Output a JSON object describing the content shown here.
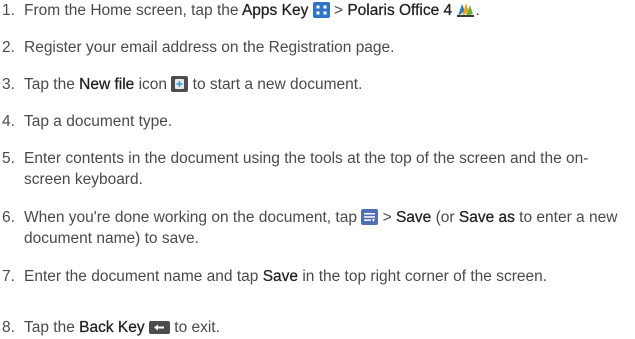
{
  "steps": [
    {
      "number": "1.",
      "parts": {
        "a": "From the Home screen, tap the ",
        "b": "Apps Key",
        "c": " > ",
        "d": "Polaris Office 4",
        "e": "."
      },
      "icons": [
        "apps-grid-icon",
        "polaris-office-icon"
      ]
    },
    {
      "number": "2.",
      "text": "Register your email address on the Registration page."
    },
    {
      "number": "3.",
      "parts": {
        "a": "Tap the ",
        "b": "New file",
        "c": " icon ",
        "d": " to start a new document."
      },
      "icons": [
        "new-file-icon"
      ]
    },
    {
      "number": "4.",
      "text": "Tap a document type."
    },
    {
      "number": "5.",
      "text": "Enter contents in the document using the tools at the top of the screen and the on-screen keyboard."
    },
    {
      "number": "6.",
      "parts": {
        "a": "When you're done working on the document, tap ",
        "b": " > ",
        "c": "Save",
        "d": " (or ",
        "e": "Save as",
        "f": " to enter a new document name) to save."
      },
      "icons": [
        "menu-icon"
      ]
    },
    {
      "number": "7.",
      "parts": {
        "a": "Enter the document name and tap ",
        "b": "Save",
        "c": " in the top right corner of the screen."
      }
    },
    {
      "number": "8.",
      "parts": {
        "a": "Tap the ",
        "b": "Back Key",
        "c": " to exit."
      },
      "icons": [
        "back-key-icon"
      ]
    }
  ],
  "colors": {
    "text": "#4a4a4a",
    "emphasis": "#1f1f1f",
    "apps_icon": "#2f74c9",
    "menu_icon": "#4f6fb0",
    "dark_icon": "#4d4d4d"
  }
}
